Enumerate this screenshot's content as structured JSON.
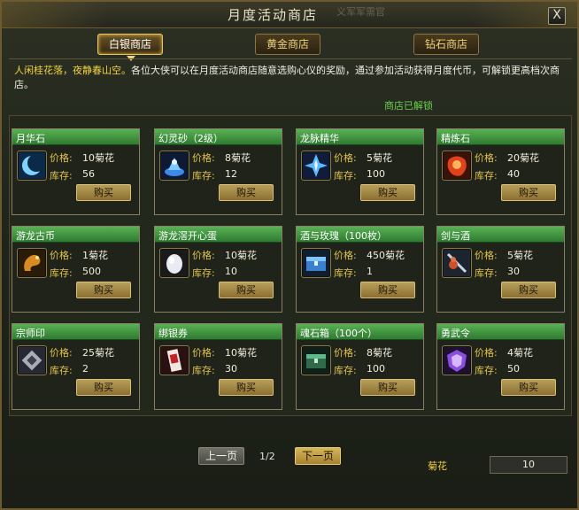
{
  "window": {
    "title": "月度活动商店",
    "ghost_text": "义军军需官",
    "close_label": "X"
  },
  "tabs": [
    {
      "label": "白银商店",
      "active": true
    },
    {
      "label": "黄金商店",
      "active": false
    },
    {
      "label": "钻石商店",
      "active": false
    }
  ],
  "description": {
    "highlight": "人闲桂花落，夜静春山空。",
    "text": "各位大侠可以在月度活动商店随意选购心仪的奖励，通过参加活动获得月度代币，可解锁更高档次商店。"
  },
  "unlock_status": "商店已解锁",
  "labels": {
    "price": "价格:",
    "stock": "库存:",
    "buy": "购买"
  },
  "items": [
    {
      "name": "月华石",
      "price": "10菊花",
      "stock": "56",
      "icon": "crescent-moon-icon"
    },
    {
      "name": "幻灵砂（2级）",
      "price": "8菊花",
      "stock": "12",
      "icon": "blue-sand-icon"
    },
    {
      "name": "龙脉精华",
      "price": "5菊花",
      "stock": "100",
      "icon": "blue-crystal-icon"
    },
    {
      "name": "精炼石",
      "price": "20菊花",
      "stock": "40",
      "icon": "red-stone-icon"
    },
    {
      "name": "游龙古币",
      "price": "1菊花",
      "stock": "500",
      "icon": "dragon-coin-icon"
    },
    {
      "name": "游龙滘开心蛋",
      "price": "10菊花",
      "stock": "10",
      "icon": "egg-icon"
    },
    {
      "name": "酒与玫瑰（100枚）",
      "price": "450菊花",
      "stock": "1",
      "icon": "blue-chest-icon"
    },
    {
      "name": "剑与酒",
      "price": "5菊花",
      "stock": "30",
      "icon": "sword-gourd-icon"
    },
    {
      "name": "宗师印",
      "price": "25菊花",
      "stock": "2",
      "icon": "seal-icon"
    },
    {
      "name": "绑银券",
      "price": "10菊花",
      "stock": "30",
      "icon": "coupon-icon"
    },
    {
      "name": "魂石箱（100个）",
      "price": "8菊花",
      "stock": "100",
      "icon": "green-chest-icon"
    },
    {
      "name": "勇武令",
      "price": "4菊花",
      "stock": "50",
      "icon": "purple-token-icon"
    }
  ],
  "pagination": {
    "prev_label": "上一页",
    "next_label": "下一页",
    "indicator": "1/2"
  },
  "currency": {
    "label": "菊花",
    "value": "10"
  },
  "colors": {
    "card_header": "#3f9a3d",
    "accent_gold": "#f2d240",
    "unlock_green": "#69d04a"
  }
}
